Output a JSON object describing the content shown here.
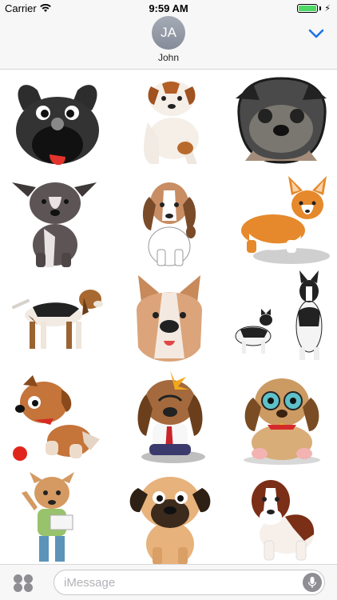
{
  "status_bar": {
    "carrier": "Carrier",
    "time": "9:59 AM",
    "battery_level": 1.0,
    "battery_color": "#4cd964"
  },
  "header": {
    "avatar_initials": "JA",
    "contact_name": "John",
    "collapse_icon": "chevron-down-icon",
    "accent_color": "#1a73e8"
  },
  "stickers": [
    {
      "name": "french-bulldog-face"
    },
    {
      "name": "bulldog-puppy"
    },
    {
      "name": "pug-face"
    },
    {
      "name": "pitbull-sitting"
    },
    {
      "name": "beagle-puppy-sitting"
    },
    {
      "name": "corgi"
    },
    {
      "name": "beagle-standing"
    },
    {
      "name": "boxer-face"
    },
    {
      "name": "husky-pair"
    },
    {
      "name": "scruffy-dog-with-ball"
    },
    {
      "name": "basset-with-tie"
    },
    {
      "name": "big-eyed-puppy"
    },
    {
      "name": "dog-reading-book"
    },
    {
      "name": "mastiff-sitting"
    },
    {
      "name": "saint-bernard"
    }
  ],
  "compose": {
    "placeholder": "iMessage",
    "apps_icon": "app-drawer-icon",
    "mic_icon": "microphone-icon"
  }
}
